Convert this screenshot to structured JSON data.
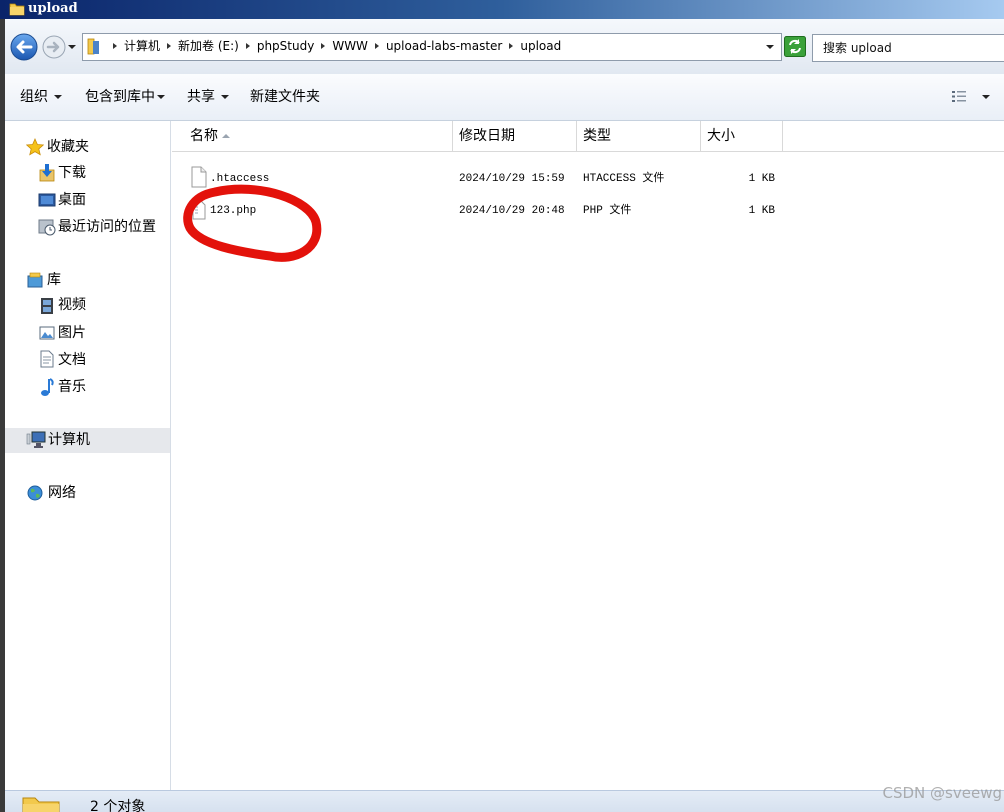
{
  "window": {
    "title": "upload"
  },
  "address": {
    "crumbs": [
      "计算机",
      "新加卷 (E:)",
      "phpStudy",
      "WWW",
      "upload-labs-master",
      "upload"
    ],
    "search_placeholder": "搜索 upload"
  },
  "toolbar": {
    "organize": "组织",
    "include_in_library": "包含到库中",
    "share": "共享",
    "new_folder": "新建文件夹"
  },
  "nav": {
    "favorites": "收藏夹",
    "downloads": "下载",
    "desktop": "桌面",
    "recent_places": "最近访问的位置",
    "libraries": "库",
    "videos": "视频",
    "pictures": "图片",
    "documents": "文档",
    "music": "音乐",
    "computer": "计算机",
    "network": "网络"
  },
  "columns": {
    "name": "名称",
    "modified": "修改日期",
    "type": "类型",
    "size": "大小"
  },
  "files": [
    {
      "name": ".htaccess",
      "modified": "2024/10/29 15:59",
      "type": "HTACCESS 文件",
      "size": "1 KB"
    },
    {
      "name": "123.php",
      "modified": "2024/10/29 20:48",
      "type": "PHP 文件",
      "size": "1 KB"
    }
  ],
  "status": {
    "item_count": "2 个对象"
  },
  "watermark": "CSDN @sveewg",
  "colors": {
    "title_bar": "#0a246a",
    "annotation": "#e3120b",
    "nav_selected": "#e6e8ec",
    "refresh": "#3aa13a"
  }
}
